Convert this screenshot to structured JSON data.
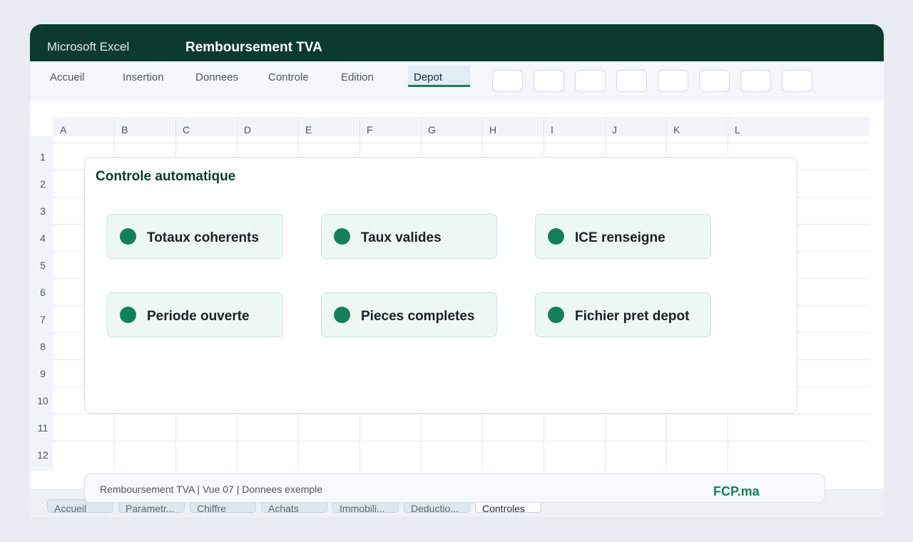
{
  "app": {
    "name": "Microsoft Excel",
    "document_title": "Remboursement TVA"
  },
  "ribbon": {
    "tabs": [
      {
        "label": "Accueil"
      },
      {
        "label": "Insertion"
      },
      {
        "label": "Donnees"
      },
      {
        "label": "Controle"
      },
      {
        "label": "Edition"
      },
      {
        "label": "Depot",
        "active": true
      }
    ],
    "tool_buttons_count": 8
  },
  "sheet": {
    "columns": [
      "A",
      "B",
      "C",
      "D",
      "E",
      "F",
      "G",
      "H",
      "I",
      "J",
      "K",
      "L"
    ],
    "rows": [
      "1",
      "2",
      "3",
      "4",
      "5",
      "6",
      "7",
      "8",
      "9",
      "10",
      "11",
      "12"
    ]
  },
  "panel": {
    "title": "Controle automatique",
    "checks": [
      {
        "label": "Totaux coherents",
        "status": "ok"
      },
      {
        "label": "Taux valides",
        "status": "ok"
      },
      {
        "label": "ICE renseigne",
        "status": "ok"
      },
      {
        "label": "Periode ouverte",
        "status": "ok"
      },
      {
        "label": "Pieces completes",
        "status": "ok"
      },
      {
        "label": "Fichier pret depot",
        "status": "ok"
      }
    ]
  },
  "status_bar": {
    "text": "Remboursement TVA | Vue 07 | Donnees exemple",
    "brand": "FCP.ma"
  },
  "sheet_tabs": [
    {
      "label": "Accueil"
    },
    {
      "label": "Parametr..."
    },
    {
      "label": "Chiffre"
    },
    {
      "label": "Achats"
    },
    {
      "label": "Immobili..."
    },
    {
      "label": "Deductio..."
    },
    {
      "label": "Controles",
      "active": true
    }
  ],
  "colors": {
    "brand_dark": "#0c3b2e",
    "accent_green": "#138158"
  }
}
